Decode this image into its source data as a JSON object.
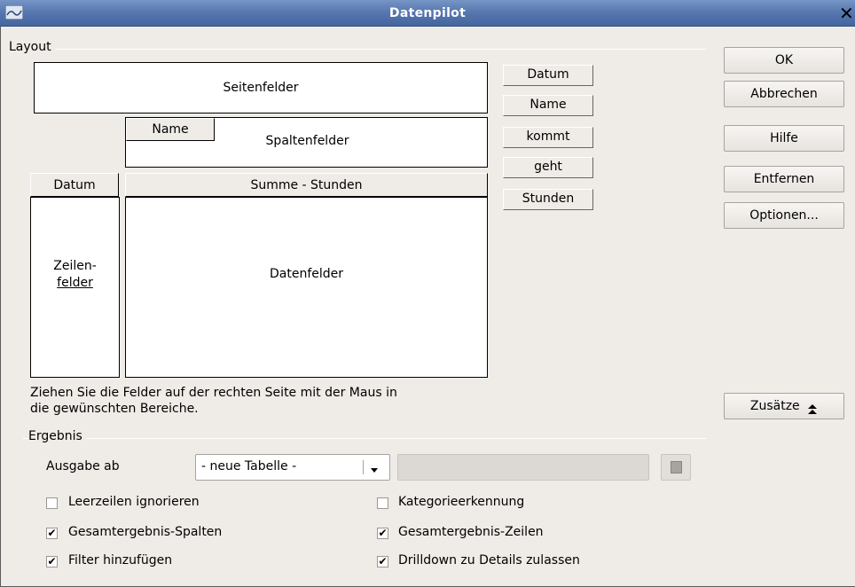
{
  "window": {
    "title": "Datenpilot",
    "close_glyph": "✕"
  },
  "layout": {
    "group_label": "Layout",
    "page_fields_label": "Seitenfelder",
    "column_fields_label": "Spaltenfelder",
    "row_fields_label_line1": "Zeilen-",
    "row_fields_label_line2": "felder",
    "data_fields_label": "Datenfelder",
    "column_field_button": "Name",
    "row_field_button": "Datum",
    "data_field_button": "Summe - Stunden",
    "available_fields": [
      "Datum",
      "Name",
      "kommt",
      "geht",
      "Stunden"
    ],
    "hint_line1": "Ziehen Sie die Felder auf der rechten Seite mit der Maus in",
    "hint_line2": "die gewünschten Bereiche."
  },
  "buttons": {
    "ok": "OK",
    "cancel": "Abbrechen",
    "help": "Hilfe",
    "remove": "Entfernen",
    "options": "Optionen...",
    "more": "Zusätze",
    "more_icon": "double-chevron-up-icon"
  },
  "result": {
    "group_label": "Ergebnis",
    "output_label": "Ausgabe ab",
    "output_select_value": "- neue Tabelle -",
    "output_cell_value": "",
    "checkboxes": [
      {
        "label": "Leerzeilen ignorieren",
        "checked": false
      },
      {
        "label": "Kategorieerkennung",
        "checked": false
      },
      {
        "label": "Gesamtergebnis-Spalten",
        "checked": true
      },
      {
        "label": "Gesamtergebnis-Zeilen",
        "checked": true
      },
      {
        "label": "Filter hinzufügen",
        "checked": true
      },
      {
        "label": "Drilldown zu Details zulassen",
        "checked": true
      }
    ]
  }
}
